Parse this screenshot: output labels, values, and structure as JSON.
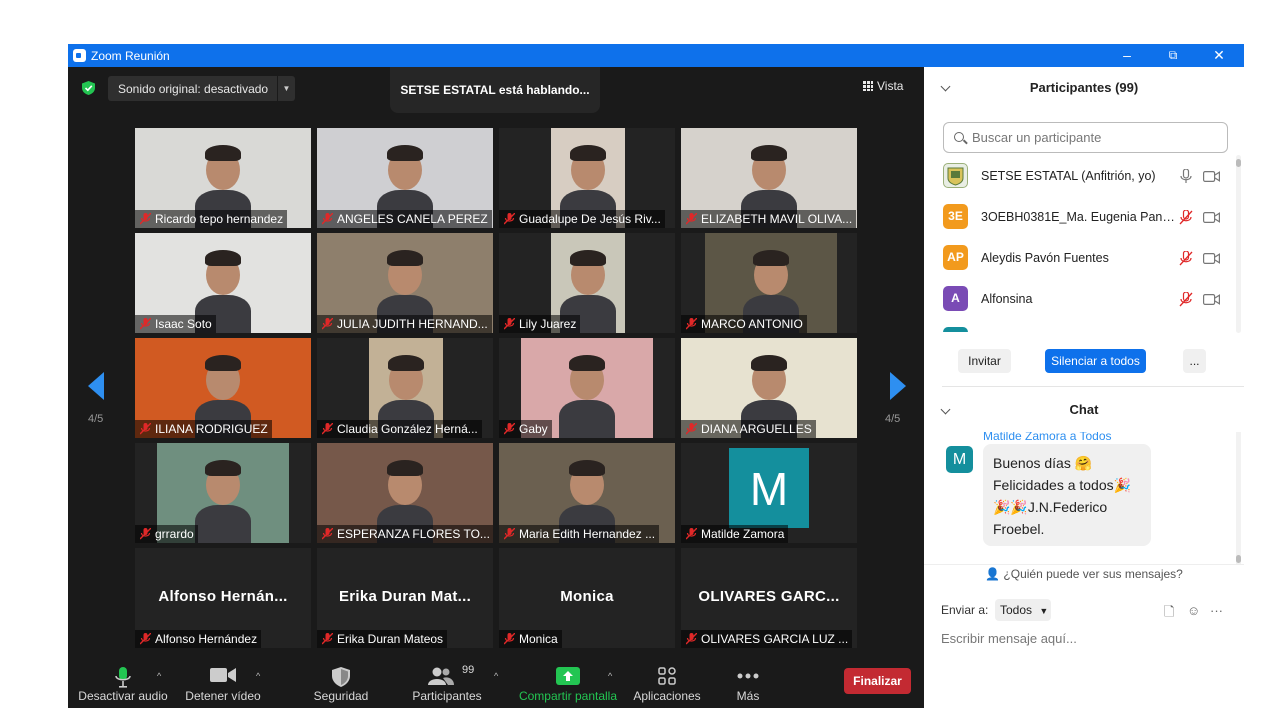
{
  "window": {
    "title": "Zoom Reunión",
    "minimize": "–",
    "restore": "⧉",
    "close": "✕"
  },
  "top": {
    "sound": "Sonido original: desactivado",
    "speaking": "SETSE ESTATAL está hablando...",
    "view": "Vista"
  },
  "pager": {
    "left": "4/5",
    "right": "4/5"
  },
  "tiles": [
    {
      "name": "Ricardo tepo hernandez",
      "bg": "#d9d9d6"
    },
    {
      "name": "ANGELES CANELA PEREZ",
      "bg": "#cfcfd2"
    },
    {
      "name": "Guadalupe De Jesús Riv...",
      "bg": "#d7cdc2"
    },
    {
      "name": "ELIZABETH MAVIL OLIVA...",
      "bg": "#d6d2cc"
    },
    {
      "name": "Isaac Soto",
      "bg": "#e2e2e0"
    },
    {
      "name": "JULIA JUDITH HERNAND...",
      "bg": "#8e7f6c"
    },
    {
      "name": "Lily Juarez",
      "bg": "#c9c7b9"
    },
    {
      "name": "MARCO ANTONIO",
      "bg": "#5c5646"
    },
    {
      "name": "ILIANA RODRIGUEZ",
      "bg": "#d15a22"
    },
    {
      "name": "Claudia González Herná...",
      "bg": "#c2b196"
    },
    {
      "name": "Gaby",
      "bg": "#d9a8a9"
    },
    {
      "name": "DIANA ARGUELLES",
      "bg": "#e7e2d0"
    },
    {
      "name": "grrardo",
      "bg": "#6f8f7f"
    },
    {
      "name": "ESPERANZA FLORES TO...",
      "bg": "#76584a"
    },
    {
      "name": "Maria Edith Hernandez ...",
      "bg": "#6b6050"
    },
    {
      "name": "Matilde Zamora",
      "initial": "M"
    },
    {
      "name": "Alfonso Hernández",
      "big": "Alfonso Hernán..."
    },
    {
      "name": "Erika Duran Mateos",
      "big": "Erika Duran Mat..."
    },
    {
      "name": "Monica",
      "big": "Monica"
    },
    {
      "name": "OLIVARES GARCIA LUZ ...",
      "big": "OLIVARES GARC..."
    }
  ],
  "toolbar": {
    "audio": "Desactivar audio",
    "video": "Detener vídeo",
    "security": "Seguridad",
    "participants": "Participantes",
    "participants_count": "99",
    "share": "Compartir pantalla",
    "apps": "Aplicaciones",
    "more": "Más",
    "end": "Finalizar"
  },
  "participants": {
    "header": "Participantes (99)",
    "search_placeholder": "Buscar un participante",
    "list": [
      {
        "name": "SETSE ESTATAL (Anfitrión, yo)",
        "initials": "",
        "color": "#e9eee4",
        "muted": false
      },
      {
        "name": "3OEBH0381E_Ma. Eugenia Pane...",
        "initials": "3E",
        "color": "#f29a1d",
        "muted": true
      },
      {
        "name": "Aleydis Pavón Fuentes",
        "initials": "AP",
        "color": "#f29a1d",
        "muted": true
      },
      {
        "name": "Alfonsina",
        "initials": "A",
        "color": "#7a4bb5",
        "muted": true
      }
    ],
    "invite": "Invitar",
    "mute_all": "Silenciar a todos",
    "more": "..."
  },
  "chat": {
    "header": "Chat",
    "from": "Matilde Zamora a Todos",
    "avatar": "M",
    "lines": [
      "Buenos días 🤗",
      "Felicidades a todos🎉",
      "🎉🎉J.N.Federico",
      "Froebel."
    ],
    "who_can_see": "¿Quién puede ver sus mensajes?",
    "send_to_label": "Enviar a:",
    "send_to_value": "Todos",
    "input_placeholder": "Escribir mensaje aquí..."
  }
}
